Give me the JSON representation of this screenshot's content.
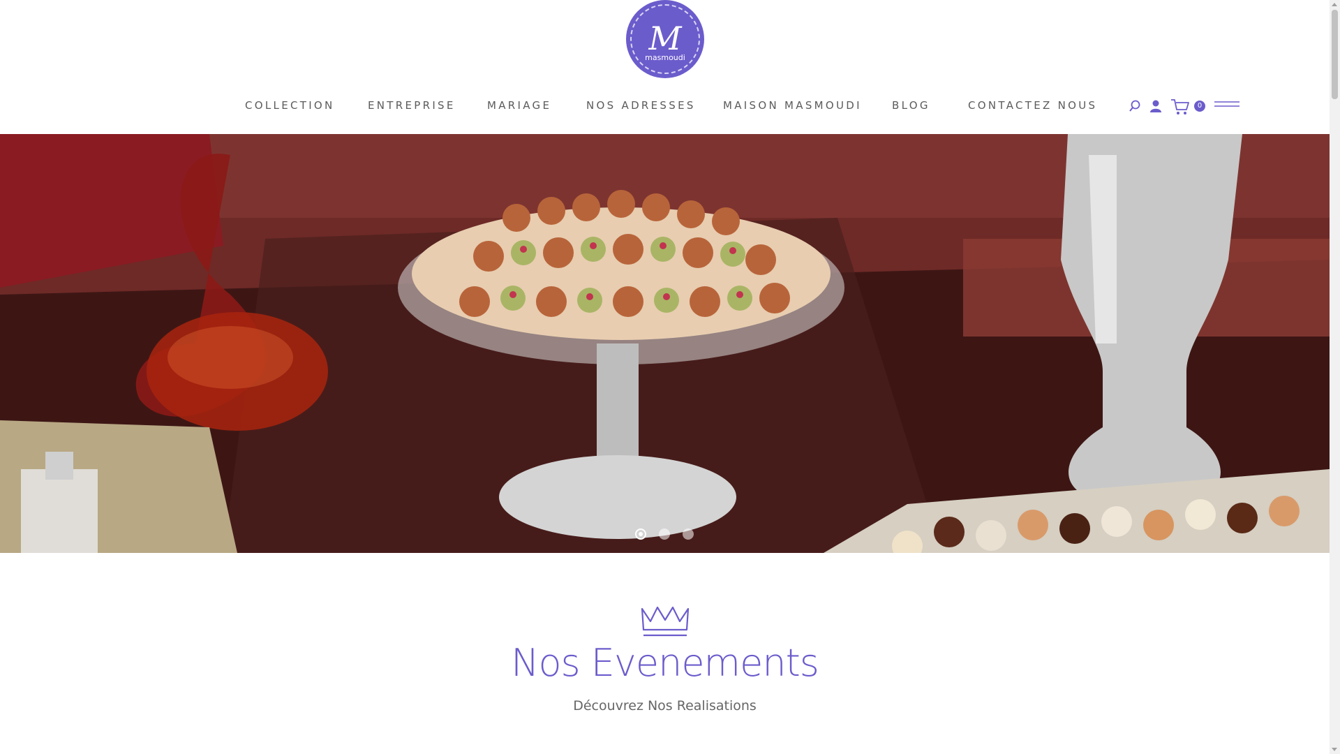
{
  "brand": {
    "logo_monogram": "M",
    "logo_text": "masmoudi",
    "accent": "#6b5ccc"
  },
  "nav": {
    "items": [
      {
        "label": "COLLECTION"
      },
      {
        "label": "ENTREPRISE"
      },
      {
        "label": "MARIAGE"
      },
      {
        "label": "NOS ADRESSES"
      },
      {
        "label": "MAISON MASMOUDI"
      },
      {
        "label": "BLOG"
      },
      {
        "label": "CONTACTEZ NOUS"
      }
    ],
    "icons": {
      "search": "search-icon",
      "user": "user-icon",
      "cart": "cart-icon",
      "menu": "hamburger-menu-icon"
    },
    "cart_count": "0"
  },
  "hero": {
    "image_description_icon": "hero-slide-image",
    "slides": 3,
    "active_slide": 1
  },
  "section": {
    "icon": "crown-icon",
    "title": "Nos Evenements",
    "subtitle": "Découvrez Nos Realisations"
  }
}
